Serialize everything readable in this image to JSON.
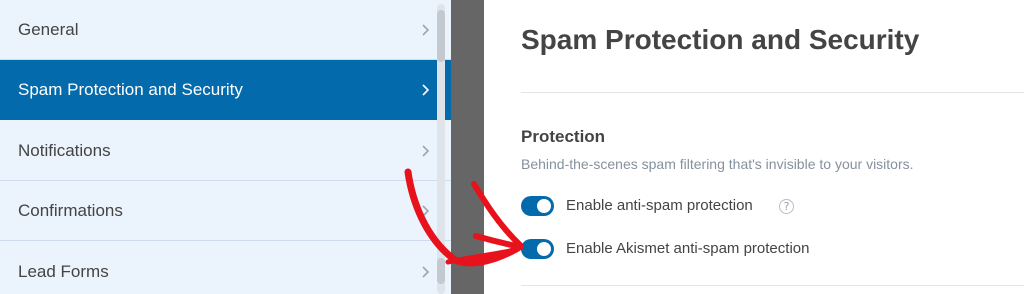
{
  "sidebar": {
    "items": [
      {
        "label": "General",
        "active": false
      },
      {
        "label": "Spam Protection and Security",
        "active": true
      },
      {
        "label": "Notifications",
        "active": false
      },
      {
        "label": "Confirmations",
        "active": false
      },
      {
        "label": "Lead Forms",
        "active": false
      }
    ]
  },
  "main": {
    "title": "Spam Protection and Security",
    "protection": {
      "heading": "Protection",
      "description": "Behind-the-scenes spam filtering that's invisible to your visitors.",
      "toggles": [
        {
          "label": "Enable anti-spam protection",
          "enabled": true,
          "help_icon": "?"
        },
        {
          "label": "Enable Akismet anti-spam protection",
          "enabled": true
        }
      ]
    }
  },
  "colors": {
    "accent": "#036aab",
    "sidebar_bg": "#ebf3fc",
    "annotation_arrow": "#e8121c"
  },
  "icons": {
    "sidebar_chevron": "chevron-right-icon",
    "help": "question-circle-icon",
    "annotation": "hand-drawn-arrow"
  }
}
